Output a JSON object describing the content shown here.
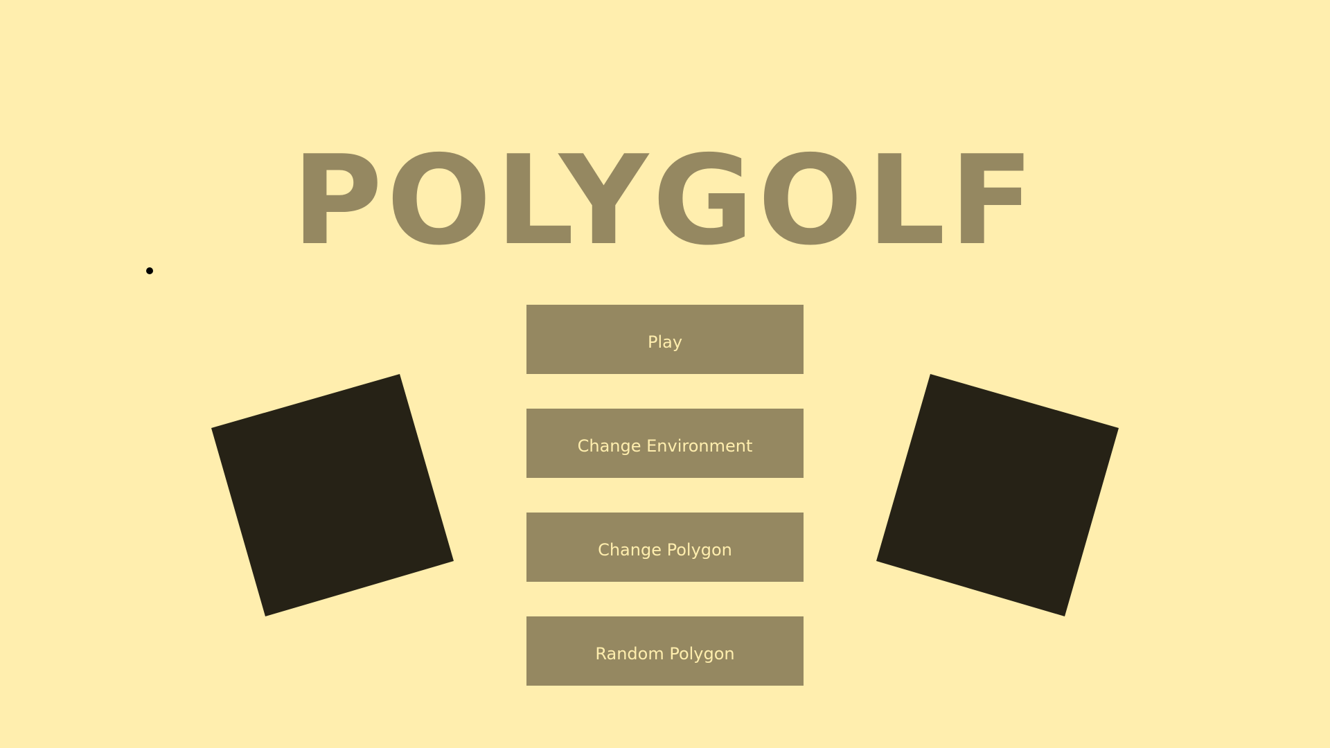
{
  "game": {
    "title": "POLYGOLF"
  },
  "menu": {
    "buttons": [
      {
        "label": "Play"
      },
      {
        "label": "Change Environment"
      },
      {
        "label": "Change Polygon"
      },
      {
        "label": "Random Polygon"
      }
    ]
  },
  "colors": {
    "background": "#FFEEAE",
    "accent": "#958861",
    "button_text": "#FFEEAE",
    "polygon": "#262216",
    "cursor": "#000000"
  },
  "decor": {
    "left_polygon": {
      "shape": "square",
      "rotation_deg": -16
    },
    "right_polygon": {
      "shape": "square",
      "rotation_deg": 16
    }
  }
}
